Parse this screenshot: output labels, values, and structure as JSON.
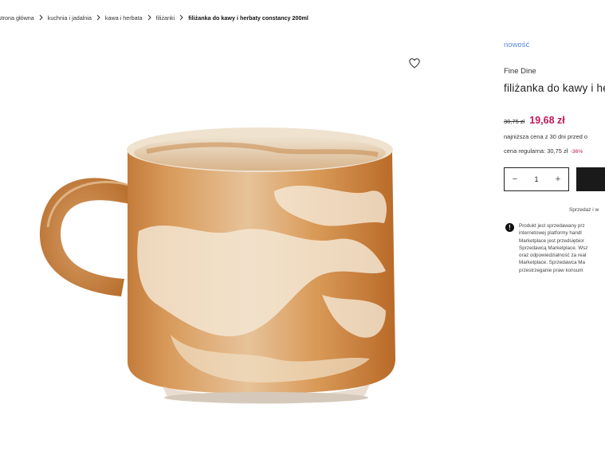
{
  "breadcrumb": {
    "items": [
      "strona główna",
      "kuchnia i jadalnia",
      "kawa i herbata",
      "filiżanki"
    ],
    "current": "filiżanka do kawy i herbaty constancy 200ml"
  },
  "gallery": {
    "wishlist_icon": "heart-outline-icon"
  },
  "product": {
    "badge": "nowość",
    "brand": "Fine Dine",
    "title": "filiżanka do kawy i he",
    "old_price": "30,75 zł",
    "price": "19,68 zł",
    "lowest_price_note": "najniższa cena z 30 dni przed o",
    "regular_price_label": "cena regularna: 30,75 zł",
    "discount": "-36%",
    "quantity": "1",
    "seller_note": "Sprzedaż i w",
    "notice_lines": [
      "Produkt jest sprzedawany prz",
      "internetowej platformy handl",
      "Marketplace jest przedsiębior",
      "Sprzedawcą Marketplace. Wsz",
      "oraz odpowiedzialność za real",
      "Marketplace. Sprzedawca Ma",
      "przestrzeganie praw konsum"
    ]
  },
  "colors": {
    "accent_link": "#5a8bd6",
    "price_highlight": "#c2185b",
    "button_dark": "#1a1a1a"
  }
}
